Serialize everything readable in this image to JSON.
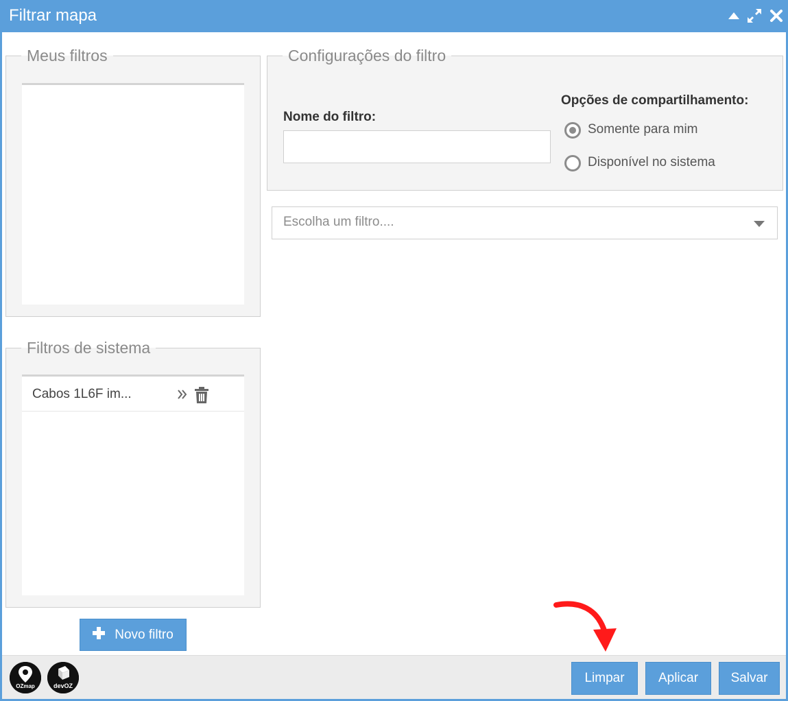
{
  "window": {
    "title": "Filtrar mapa",
    "accent_color": "#5b9fdb",
    "controls": [
      "collapse-icon",
      "expand-icon",
      "close-icon"
    ]
  },
  "my_filters": {
    "legend": "Meus filtros"
  },
  "system_filters": {
    "legend": "Filtros de sistema",
    "items": [
      {
        "label": "Cabos 1L6F im...",
        "icons": [
          "double-chevron-right-icon",
          "trash-icon"
        ]
      }
    ]
  },
  "new_filter_button": {
    "label": "Novo filtro",
    "icon": "plus-icon"
  },
  "filter_config": {
    "legend": "Configurações do filtro",
    "name_label": "Nome do filtro:",
    "name_value": "",
    "sharing_label": "Opções de compartilhamento:",
    "sharing_options": [
      {
        "label": "Somente para mim",
        "checked": true
      },
      {
        "label": "Disponível no sistema",
        "checked": false
      }
    ]
  },
  "filter_select": {
    "placeholder": "Escolha um filtro...."
  },
  "footer": {
    "logos": [
      {
        "name": "ozmap-logo",
        "text": "OZmap"
      },
      {
        "name": "devoz-logo",
        "text": "devOZ"
      }
    ],
    "buttons": {
      "clear": "Limpar",
      "apply": "Aplicar",
      "save": "Salvar"
    }
  },
  "annotation": {
    "arrow_color": "#ff1a1a"
  }
}
